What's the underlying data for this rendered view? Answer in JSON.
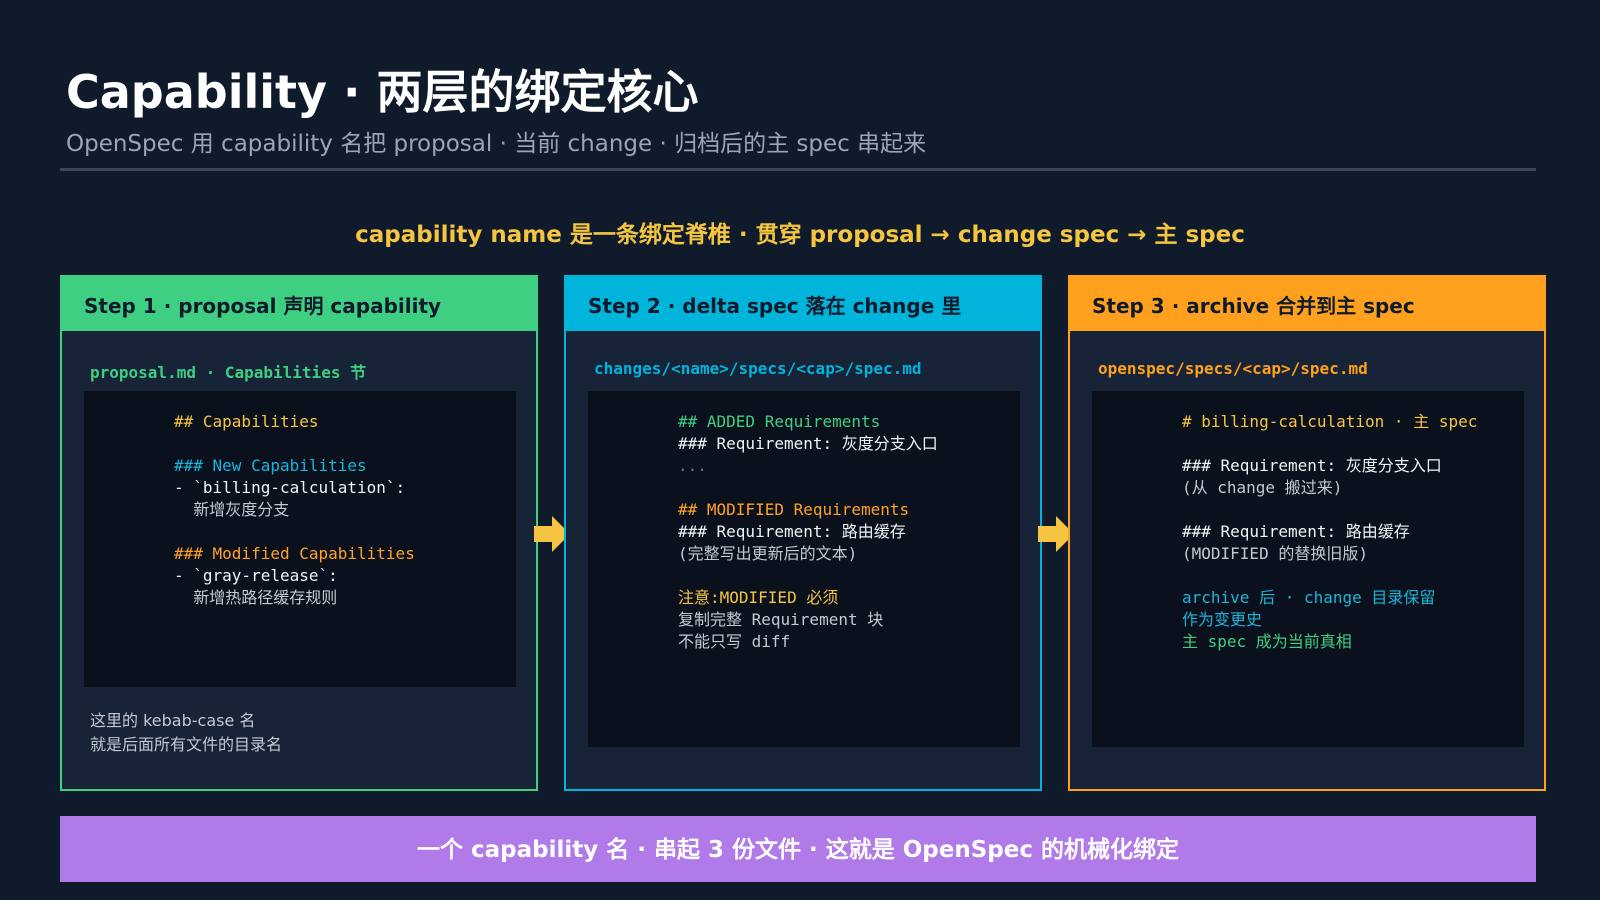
{
  "header": {
    "title": "Capability · 两层的绑定核心",
    "subtitle": "OpenSpec 用 capability 名把 proposal · 当前 change · 归档后的主 spec 串起来"
  },
  "spine_text": "capability name 是一条绑定脊椎 · 贯穿 proposal → change spec → 主 spec",
  "colors": {
    "background": "#0f1a2b",
    "step1": "#3ecf82",
    "step2": "#00b4dc",
    "step3": "#ffa01e",
    "accent_yellow": "#f5c542",
    "banner": "#b07ae8"
  },
  "steps": [
    {
      "header": "Step 1 · proposal 声明 capability",
      "path": "proposal.md · Capabilities 节",
      "code": [
        {
          "text": "## Capabilities",
          "tone": "yellow"
        },
        {
          "text": "",
          "tone": "white"
        },
        {
          "text": "### New Capabilities",
          "tone": "cyan"
        },
        {
          "text": "- `billing-calculation`:",
          "tone": "white"
        },
        {
          "text": "  新增灰度分支",
          "tone": "gray"
        },
        {
          "text": "",
          "tone": "white"
        },
        {
          "text": "### Modified Capabilities",
          "tone": "orange"
        },
        {
          "text": "- `gray-release`:",
          "tone": "white"
        },
        {
          "text": "  新增热路径缓存规则",
          "tone": "gray"
        }
      ],
      "note": [
        "这里的 kebab-case 名",
        "就是后面所有文件的目录名"
      ]
    },
    {
      "header": "Step 2 · delta spec 落在 change 里",
      "path": "changes/<name>/specs/<cap>/spec.md",
      "code": [
        {
          "text": "## ADDED Requirements",
          "tone": "green"
        },
        {
          "text": "### Requirement: 灰度分支入口",
          "tone": "white"
        },
        {
          "text": "...",
          "tone": "dim"
        },
        {
          "text": "",
          "tone": "white"
        },
        {
          "text": "## MODIFIED Requirements",
          "tone": "orange"
        },
        {
          "text": "### Requirement: 路由缓存",
          "tone": "white"
        },
        {
          "text": "(完整写出更新后的文本)",
          "tone": "gray"
        },
        {
          "text": "",
          "tone": "white"
        },
        {
          "text": "注意:MODIFIED 必须",
          "tone": "yellow"
        },
        {
          "text": "复制完整 Requirement 块",
          "tone": "gray"
        },
        {
          "text": "不能只写 diff",
          "tone": "gray"
        }
      ],
      "note": []
    },
    {
      "header": "Step 3 · archive 合并到主 spec",
      "path": "openspec/specs/<cap>/spec.md",
      "code": [
        {
          "text": "# billing-calculation · 主 spec",
          "tone": "yellow"
        },
        {
          "text": "",
          "tone": "white"
        },
        {
          "text": "### Requirement: 灰度分支入口",
          "tone": "white"
        },
        {
          "text": "(从 change 搬过来)",
          "tone": "gray"
        },
        {
          "text": "",
          "tone": "white"
        },
        {
          "text": "### Requirement: 路由缓存",
          "tone": "white"
        },
        {
          "text": "(MODIFIED 的替换旧版)",
          "tone": "gray"
        },
        {
          "text": "",
          "tone": "white"
        },
        {
          "text": "archive 后 · change 目录保留",
          "tone": "cyan"
        },
        {
          "text": "作为变更史",
          "tone": "cyan"
        },
        {
          "text": "主 spec 成为当前真相",
          "tone": "green"
        }
      ],
      "note": []
    }
  ],
  "banner": "一个 capability 名 · 串起 3 份文件 · 这就是 OpenSpec 的机械化绑定"
}
